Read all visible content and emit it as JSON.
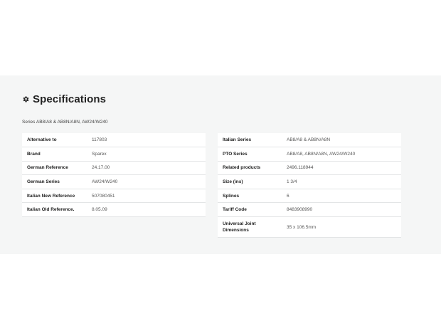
{
  "title": "Specifications",
  "series_text": "Series AB8/A8 & AB8N/A8N, AW24/W240",
  "left_table": [
    {
      "key": "Alternative to",
      "value": "117803"
    },
    {
      "key": "Brand",
      "value": "Sparex"
    },
    {
      "key": "German Reference",
      "value": "24.17.00"
    },
    {
      "key": "German Series",
      "value": "AW24/W240"
    },
    {
      "key": "Italian New Reference",
      "value": "507080451"
    },
    {
      "key": "Italian Old Reference.",
      "value": "8.05.09"
    }
  ],
  "right_table": [
    {
      "key": "Italian Series",
      "value": "AB8/A8 & AB8N/A8N"
    },
    {
      "key": "PTO Series",
      "value": "AB8/A8, AB8N/A8N, AW24/W240"
    },
    {
      "key": "Related products",
      "value": "2496.118944"
    },
    {
      "key": "Size (ins)",
      "value": "1 3/4"
    },
    {
      "key": "Splines",
      "value": "6"
    },
    {
      "key": "Tariff Code",
      "value": "8483908990"
    },
    {
      "key": "Universal Joint Dimensions",
      "value": "35 x 106.5mm"
    }
  ],
  "colors": {
    "section_bg": "#f5f6f6",
    "row_border": "#e3e5e6"
  },
  "icons": {
    "heading_icon": "gear-icon"
  }
}
